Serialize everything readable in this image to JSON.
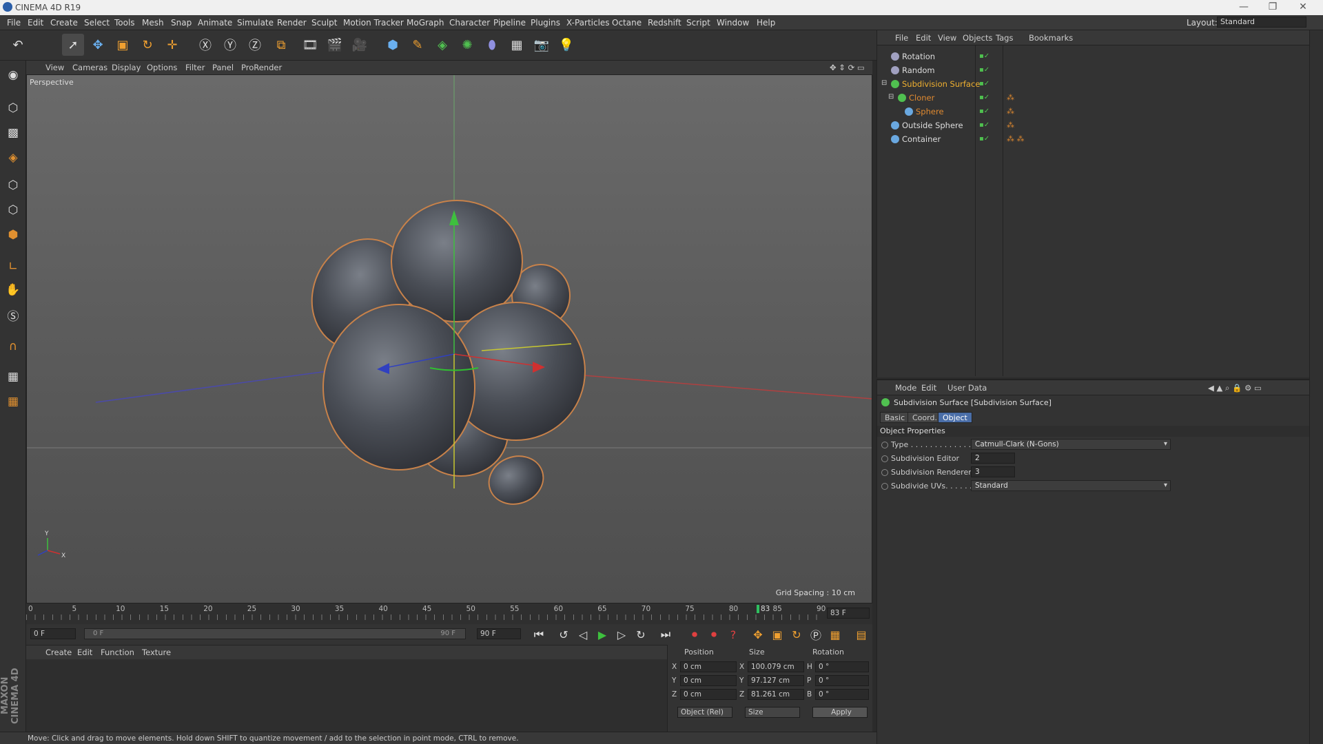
{
  "window": {
    "title": "CINEMA 4D R19",
    "minimize": "—",
    "restore": "❐",
    "close": "✕"
  },
  "menubar": [
    "File",
    "Edit",
    "Create",
    "Select",
    "Tools",
    "Mesh",
    "Snap",
    "Animate",
    "Simulate",
    "Render",
    "Sculpt",
    "Motion Tracker",
    "MoGraph",
    "Character",
    "Pipeline",
    "Plugins",
    "X-Particles",
    "Octane",
    "Redshift",
    "Script",
    "Window",
    "Help"
  ],
  "layout": {
    "label": "Layout:",
    "value": "Standard"
  },
  "viewport": {
    "menu": [
      "View",
      "Cameras",
      "Display",
      "Options",
      "Filter",
      "Panel",
      "ProRender"
    ],
    "label": "Perspective",
    "grid_spacing": "Grid Spacing : 10 cm",
    "axis_y_label": "Y",
    "axis_x_label": "X"
  },
  "timeline": {
    "ticks": [
      "0",
      "5",
      "10",
      "15",
      "20",
      "25",
      "30",
      "35",
      "40",
      "45",
      "50",
      "55",
      "60",
      "65",
      "70",
      "75",
      "80",
      "85",
      "90"
    ],
    "current_marker": "83",
    "current_frame": "83 F",
    "start_frame": "0 F",
    "range_start": "0 F",
    "range_end": "90 F",
    "end_frame": "90 F"
  },
  "material_menu": [
    "Create",
    "Edit",
    "Function",
    "Texture"
  ],
  "coords": {
    "headers": {
      "position": "Position",
      "size": "Size",
      "rotation": "Rotation"
    },
    "rows": [
      {
        "axis": "X",
        "pos": "0 cm",
        "saxis": "X",
        "size": "100.079 cm",
        "raxis": "H",
        "rot": "0 °"
      },
      {
        "axis": "Y",
        "pos": "0 cm",
        "saxis": "Y",
        "size": "97.127 cm",
        "raxis": "P",
        "rot": "0 °"
      },
      {
        "axis": "Z",
        "pos": "0 cm",
        "saxis": "Z",
        "size": "81.261 cm",
        "raxis": "B",
        "rot": "0 °"
      }
    ],
    "mode": "Object (Rel)",
    "size_mode": "Size",
    "apply": "Apply"
  },
  "status": "Move: Click and drag to move elements. Hold down SHIFT to quantize movement / add to the selection in point mode, CTRL to remove.",
  "object_manager": {
    "menu": [
      "File",
      "Edit",
      "View",
      "Objects",
      "Tags",
      "Bookmarks"
    ],
    "objects": [
      {
        "name": "Rotation",
        "color": "#dddddd"
      },
      {
        "name": "Random",
        "color": "#dddddd"
      },
      {
        "name": "Subdivision Surface",
        "color": "#f0b030"
      },
      {
        "name": "Cloner",
        "color": "#e08a30"
      },
      {
        "name": "Sphere",
        "color": "#e08a30"
      },
      {
        "name": "Outside Sphere",
        "color": "#dddddd"
      },
      {
        "name": "Container",
        "color": "#dddddd"
      }
    ]
  },
  "attributes": {
    "menu": [
      "Mode",
      "Edit",
      "User Data"
    ],
    "title": "Subdivision Surface [Subdivision Surface]",
    "tabs": [
      "Basic",
      "Coord.",
      "Object"
    ],
    "section": "Object Properties",
    "props": [
      {
        "label": "Type . . . . . . . . . . . . .",
        "value": "Catmull-Clark (N-Gons)",
        "kind": "dropdown"
      },
      {
        "label": "Subdivision Editor",
        "value": "2",
        "kind": "number"
      },
      {
        "label": "Subdivision Renderer",
        "value": "3",
        "kind": "number"
      },
      {
        "label": "Subdivide UVs. . . . . .",
        "value": "Standard",
        "kind": "dropdown"
      }
    ]
  },
  "brand": "MAXON CINEMA 4D",
  "colors": {
    "accent": "#4a6ea8",
    "selection": "#f0b030"
  }
}
